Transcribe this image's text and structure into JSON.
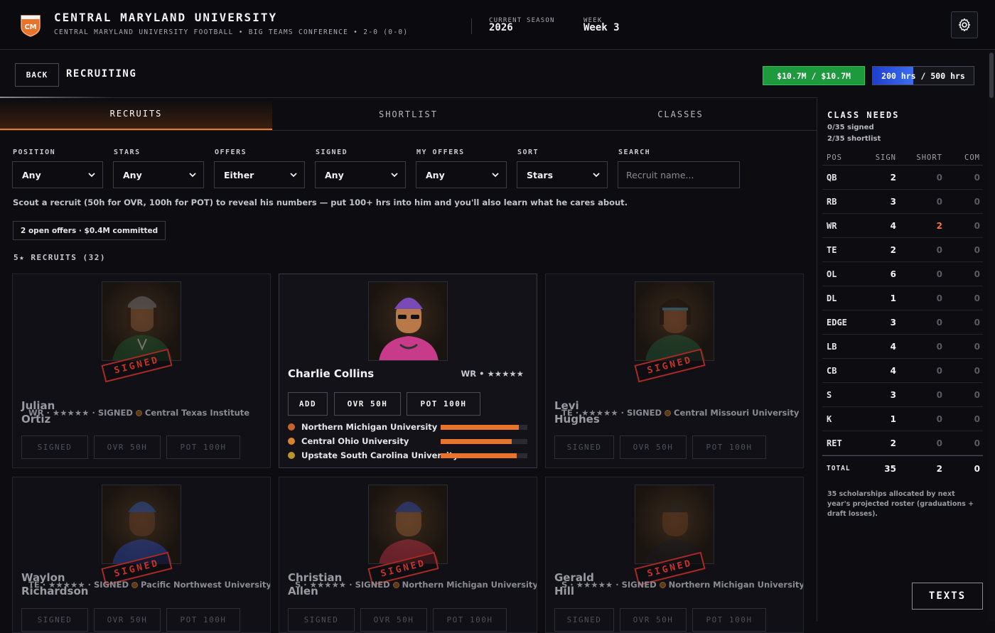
{
  "header": {
    "logo_text": "CM",
    "title": "CENTRAL MARYLAND UNIVERSITY",
    "subtitle": "CENTRAL MARYLAND UNIVERSITY FOOTBALL • BIG TEAMS CONFERENCE • 2-0 (0-0)",
    "season_label": "CURRENT SEASON",
    "season_value": "2026",
    "week_label": "WEEK",
    "week_value": "Week 3"
  },
  "page": {
    "back_label": "BACK",
    "title": "RECRUITING",
    "budget": "$10.7M / $10.7M",
    "hours": "200 hrs / 500 hrs",
    "hours_fill_fraction": 0.4
  },
  "tabs": [
    {
      "label": "RECRUITS",
      "active": true
    },
    {
      "label": "SHORTLIST",
      "active": false
    },
    {
      "label": "CLASSES",
      "active": false
    }
  ],
  "filters": [
    {
      "label": "POSITION",
      "value": "Any"
    },
    {
      "label": "STARS",
      "value": "Any"
    },
    {
      "label": "OFFERS",
      "value": "Either"
    },
    {
      "label": "SIGNED",
      "value": "Any"
    },
    {
      "label": "MY OFFERS",
      "value": "Any"
    },
    {
      "label": "SORT",
      "value": "Stars"
    }
  ],
  "search": {
    "label": "SEARCH",
    "placeholder": "Recruit name..."
  },
  "hint": "Scout a recruit (50h for OVR, 100h for POT) to reveal his numbers — put 100+ hrs into him and you'll also learn what he cares about.",
  "offers_chip": "2 open offers · $0.4M committed",
  "section_label": "5★ RECRUITS (32)",
  "stamp_text": "SIGNED",
  "cards": [
    {
      "first": "Julian",
      "last": "Ortiz",
      "meta": "WR · ★★★★★ · SIGNED",
      "school": "Central Texas Institute",
      "btn1": "SIGNED",
      "btn2": "OVR 50H",
      "btn3": "POT 100H"
    },
    {
      "first": "Levi",
      "last": "Hughes",
      "meta": "TE · ★★★★★ · SIGNED",
      "school": "Central Missouri University",
      "btn1": "SIGNED",
      "btn2": "OVR 50H",
      "btn3": "POT 100H"
    },
    {
      "first": "Waylon",
      "last": "Richardson",
      "meta": "TE · ★★★★★ · SIGNED",
      "school": "Pacific Northwest University",
      "btn1": "SIGNED",
      "btn2": "OVR 50H",
      "btn3": "POT 100H"
    },
    {
      "first": "Christian",
      "last": "Allen",
      "meta": "S · ★★★★★ · SIGNED",
      "school": "Northern Michigan University",
      "btn1": "SIGNED",
      "btn2": "OVR 50H",
      "btn3": "POT 100H"
    },
    {
      "first": "Gerald",
      "last": "Hill",
      "meta": "S · ★★★★★ · SIGNED",
      "school": "Northern Michigan University",
      "btn1": "SIGNED",
      "btn2": "OVR 50H",
      "btn3": "POT 100H"
    }
  ],
  "featured": {
    "name": "Charlie Collins",
    "pos_stars": "WR • ★★★★★",
    "add_label": "ADD",
    "ovr_label": "OVR 50H",
    "pot_label": "POT 100H",
    "interest": [
      {
        "school": "Northern Michigan University",
        "level": 0.9,
        "color": "#c8622a"
      },
      {
        "school": "Central Ohio University",
        "level": 0.82,
        "color": "#d8842a"
      },
      {
        "school": "Upstate South Carolina University",
        "level": 0.88,
        "color": "#b8952a"
      }
    ]
  },
  "class_needs": {
    "title": "CLASS NEEDS",
    "signed_line": "0/35 signed",
    "shortlist_line": "2/35 shortlist",
    "columns": [
      "POS",
      "SIGN",
      "SHORT",
      "COM"
    ],
    "rows": [
      {
        "pos": "QB",
        "sign": "2",
        "short": "0",
        "com": "0"
      },
      {
        "pos": "RB",
        "sign": "3",
        "short": "0",
        "com": "0"
      },
      {
        "pos": "WR",
        "sign": "4",
        "short": "2",
        "com": "0"
      },
      {
        "pos": "TE",
        "sign": "2",
        "short": "0",
        "com": "0"
      },
      {
        "pos": "OL",
        "sign": "6",
        "short": "0",
        "com": "0"
      },
      {
        "pos": "DL",
        "sign": "1",
        "short": "0",
        "com": "0"
      },
      {
        "pos": "EDGE",
        "sign": "3",
        "short": "0",
        "com": "0"
      },
      {
        "pos": "LB",
        "sign": "4",
        "short": "0",
        "com": "0"
      },
      {
        "pos": "CB",
        "sign": "4",
        "short": "0",
        "com": "0"
      },
      {
        "pos": "S",
        "sign": "3",
        "short": "0",
        "com": "0"
      },
      {
        "pos": "K",
        "sign": "1",
        "short": "0",
        "com": "0"
      },
      {
        "pos": "RET",
        "sign": "2",
        "short": "0",
        "com": "0"
      }
    ],
    "total": {
      "label": "TOTAL",
      "sign": "35",
      "short": "2",
      "com": "0"
    },
    "note": "35 scholarships allocated by next year's projected roster (graduations + draft losses)."
  },
  "texts_label": "TEXTS",
  "colors": {
    "accent": "#e8732a",
    "money": "#1d9a3c",
    "hours": "#3c6df0",
    "stamp": "#c8322a"
  }
}
